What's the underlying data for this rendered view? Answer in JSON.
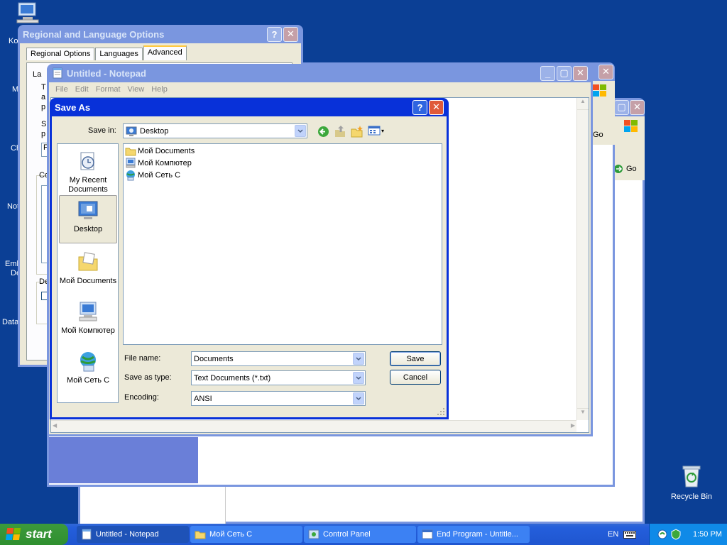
{
  "desktop": {
    "icons": [
      {
        "label": "Ko"
      },
      {
        "label": "M"
      },
      {
        "label": "Ch"
      },
      {
        "label": "Not"
      },
      {
        "label": "Emb"
      },
      {
        "label": "De"
      },
      {
        "label": "Data"
      }
    ],
    "recycle_bin": "Recycle Bin"
  },
  "regional": {
    "title": "Regional and Language Options",
    "help": "?",
    "close": "✕",
    "tabs": [
      "Regional Options",
      "Languages",
      "Advanced"
    ],
    "fragments": {
      "la": "La",
      "co": "Co",
      "de": "De",
      "t": "T",
      "a": "a",
      "p": "p",
      "s": "S",
      "f": "F"
    }
  },
  "browser": {
    "go1": "Go",
    "go2": "Go"
  },
  "notepad": {
    "title": "Untitled - Notepad",
    "menu": [
      "File",
      "Edit",
      "Format",
      "View",
      "Help"
    ]
  },
  "saveas": {
    "title": "Save As",
    "save_in_label": "Save in:",
    "save_in_value": "Desktop",
    "places": [
      "My Recent\nDocuments",
      "Desktop",
      "Мой Documents",
      "Мой  Компютер",
      "Мой Сеть С"
    ],
    "files": [
      "Мой Documents",
      "Мой  Компютер",
      "Мой Сеть С"
    ],
    "file_name_label": "File name:",
    "file_name_value": "Documents",
    "save_type_label": "Save as type:",
    "save_type_value": "Text Documents (*.txt)",
    "encoding_label": "Encoding:",
    "encoding_value": "ANSI",
    "save_button": "Save",
    "cancel_button": "Cancel"
  },
  "taskbar": {
    "start": "start",
    "tasks": [
      "Untitled - Notepad",
      "Мой Сеть С",
      "Control Panel",
      "End Program - Untitle..."
    ],
    "lang": "EN",
    "clock": "1:50 PM"
  }
}
